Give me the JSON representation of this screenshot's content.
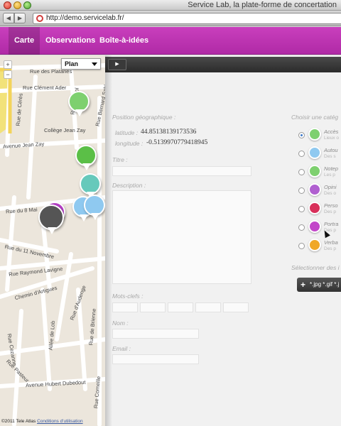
{
  "window": {
    "title": "Service Lab, la plate-forme de concertation"
  },
  "browser": {
    "url": "http://demo.servicelab.fr/"
  },
  "nav": {
    "tabs": [
      "Carte",
      "Observations",
      "Boîte-à-idées"
    ]
  },
  "map": {
    "type_selector": "Plan",
    "zoom_in": "+",
    "zoom_out": "−",
    "streets": [
      "Rue des Platanes",
      "Rue Clément Ader",
      "Rue Lauriol",
      "Rue Bernard Sablon",
      "Collège Jean Zay",
      "Avenue Jean Zay",
      "Rue de Cérès",
      "Rue du 8 Mai",
      "Rue du 11 Novembre",
      "Rue Raymond Lavigne",
      "Chemin d'Artigues",
      "Rue d'Audenge",
      "Allée de Lob",
      "Rue de Brienne",
      "Rue Cezanne",
      "Rue Pasteur",
      "Avenue Hubert Dubedout",
      "Rue Corneille"
    ],
    "attribution": "©2011 Tele Atlas",
    "attribution_link": "Conditions d'utilisation",
    "pin_colors": [
      "#7ed06f",
      "#5bbf47",
      "#66c9bb",
      "#8fc9f0",
      "#8fc9f0",
      "#555555",
      "#b23ec3"
    ]
  },
  "form": {
    "toolbar_button": "▶",
    "location_label": "Position géographique :",
    "latitude_label": "latitude :",
    "latitude_value": "44.85138139173536",
    "longitude_label": "longitude :",
    "longitude_value": "-0.5139970779418945",
    "title_label": "Titre :",
    "description_label": "Description :",
    "keywords_label": "Mots-clefs :",
    "name_label": "Nom :",
    "email_label": "Email :",
    "category_label": "Choisir une catég",
    "categories": [
      {
        "name": "Accès",
        "desc": "Lieux o",
        "color": "#7ed06f"
      },
      {
        "name": "Autou",
        "desc": "Des s",
        "color": "#8fc9f0"
      },
      {
        "name": "Notep",
        "desc": "Les p",
        "color": "#7ed06f"
      },
      {
        "name": "Opini",
        "desc": "Des o",
        "color": "#b05fd0"
      },
      {
        "name": "Perso",
        "desc": "Des p",
        "color": "#d8305a"
      },
      {
        "name": "Portra",
        "desc": "Des p",
        "color": "#c246c9"
      },
      {
        "name": "Verba",
        "desc": "Des p",
        "color": "#f0a828"
      }
    ],
    "select_label": "Sélectionner des i",
    "upload_label": "*.jpg *.gif *.j"
  }
}
